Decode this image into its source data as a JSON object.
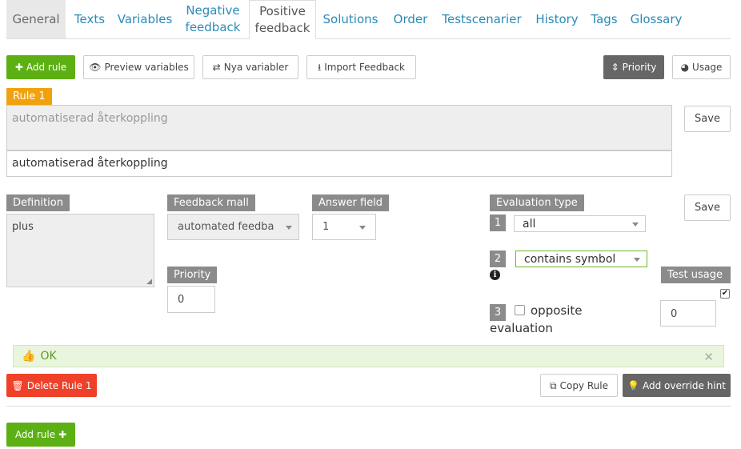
{
  "tabs": [
    {
      "line1": "General",
      "line2": ""
    },
    {
      "line1": "Texts",
      "line2": ""
    },
    {
      "line1": "Variables",
      "line2": ""
    },
    {
      "line1": "Negative",
      "line2": "feedback"
    },
    {
      "line1": "Positive",
      "line2": "feedback"
    },
    {
      "line1": "Solutions",
      "line2": ""
    },
    {
      "line1": "Order",
      "line2": ""
    },
    {
      "line1": "Testscenarier",
      "line2": ""
    },
    {
      "line1": "History",
      "line2": ""
    },
    {
      "line1": "Tags",
      "line2": ""
    },
    {
      "line1": "Glossary",
      "line2": ""
    }
  ],
  "toolbar": {
    "add_rule": "Add rule",
    "preview_variables": "Preview variables",
    "nya_variabler": "Nya variabler",
    "import_feedback": "Import Feedback",
    "priority": "Priority",
    "usage": "Usage"
  },
  "rule": {
    "tag": "Rule 1",
    "feedback_preview": "automatiserad återkoppling",
    "feedback_input": "automatiserad återkoppling",
    "save_top": "Save",
    "definition_label": "Definition",
    "definition_value": "plus",
    "feedback_mall_label": "Feedback mall",
    "feedback_mall_value": "automated feedba",
    "answer_field_label": "Answer field",
    "answer_field_value": "1",
    "priority_label": "Priority",
    "priority_value": "0",
    "evaluation_type_label": "Evaluation type",
    "eval_1_num": "1",
    "eval_1_value": "all",
    "eval_2_num": "2",
    "eval_2_value": "contains symbol",
    "eval_3_num": "3",
    "eval_3_line1": "opposite",
    "eval_3_line2": "evaluation",
    "save_mid": "Save",
    "test_usage_label": "Test usage",
    "test_usage_value": "0",
    "status_text": "OK",
    "delete_rule": "Delete Rule 1",
    "copy_rule": "Copy Rule",
    "add_override_hint": "Add override hint"
  },
  "bottom": {
    "add_rule": "Add rule"
  },
  "colors": {
    "green": "#5cb013",
    "red": "#ef4129",
    "orange": "#f0a20e",
    "link": "#2a8ab8",
    "tag_gray": "#8b8b8b",
    "dark_button": "#666666"
  },
  "icons": {
    "add": "plus-icon",
    "preview": "eye-icon",
    "nya": "retweet-icon",
    "import": "download-icon",
    "priority": "sort-icon",
    "usage": "pie-chart-icon",
    "info": "info-circle-icon",
    "ok": "thumbs-up-icon",
    "close": "close-icon",
    "delete": "trash-icon",
    "copy": "copy-icon",
    "hint": "lightbulb-icon"
  }
}
